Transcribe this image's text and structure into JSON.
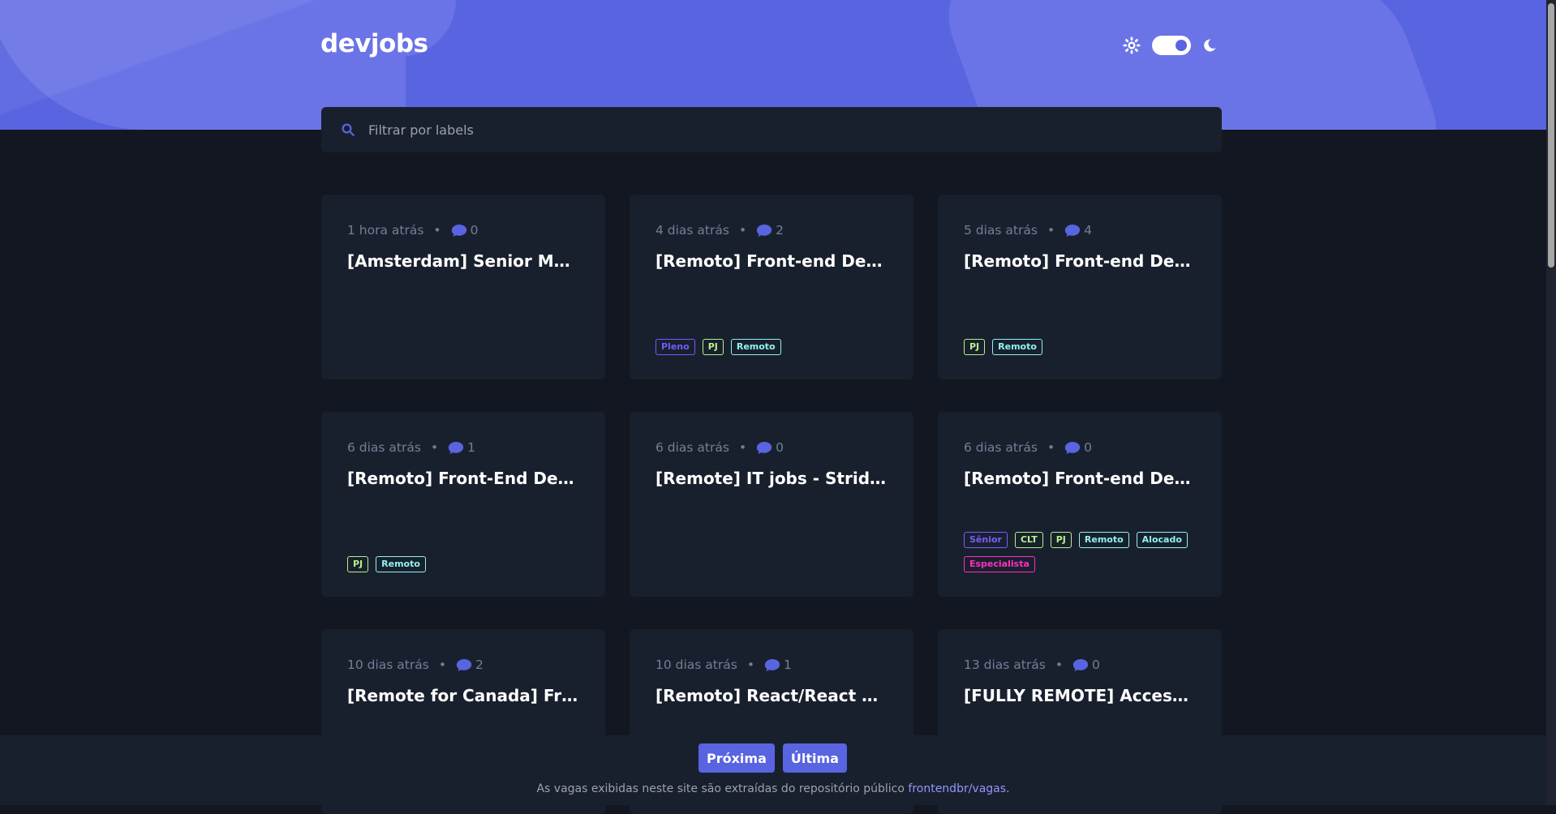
{
  "brand": {
    "logo": "devjobs"
  },
  "theme": {
    "mode": "dark"
  },
  "search": {
    "placeholder": "Filtrar por labels",
    "value": ""
  },
  "colors": {
    "accent": "#5964e0",
    "background": "#121721",
    "card": "#19202d",
    "tag_pleno": "#6f5bff",
    "tag_senior": "#7a5cff",
    "tag_pj": "#b6f08a",
    "tag_clt": "#b6f08a",
    "tag_remoto": "#8ff3ee",
    "tag_alocado": "#8ff3ee",
    "tag_especialista": "#ff2fbf"
  },
  "jobs": [
    {
      "time": "1 hora atrás",
      "comments": "0",
      "title": "[Amsterdam] Senior Mobile Engineer",
      "tags": []
    },
    {
      "time": "4 dias atrás",
      "comments": "2",
      "title": "[Remoto] Front-end Developer",
      "tags": [
        {
          "label": "Pleno",
          "color": "#6f5bff"
        },
        {
          "label": "PJ",
          "color": "#b6f08a"
        },
        {
          "label": "Remoto",
          "color": "#8ff3ee"
        }
      ]
    },
    {
      "time": "5 dias atrás",
      "comments": "4",
      "title": "[Remoto] Front-end Developer",
      "tags": [
        {
          "label": "PJ",
          "color": "#b6f08a"
        },
        {
          "label": "Remoto",
          "color": "#8ff3ee"
        }
      ]
    },
    {
      "time": "6 dias atrás",
      "comments": "1",
      "title": "[Remoto] Front-End Developer",
      "tags": [
        {
          "label": "PJ",
          "color": "#b6f08a"
        },
        {
          "label": "Remoto",
          "color": "#8ff3ee"
        }
      ]
    },
    {
      "time": "6 dias atrás",
      "comments": "0",
      "title": "[Remote] IT jobs - Strider",
      "tags": []
    },
    {
      "time": "6 dias atrás",
      "comments": "0",
      "title": "[Remoto] Front-end Developer",
      "tags": [
        {
          "label": "Sênior",
          "color": "#7a5cff"
        },
        {
          "label": "CLT",
          "color": "#b6f08a"
        },
        {
          "label": "PJ",
          "color": "#b6f08a"
        },
        {
          "label": "Remoto",
          "color": "#8ff3ee"
        },
        {
          "label": "Alocado",
          "color": "#8ff3ee"
        },
        {
          "label": "Especialista",
          "color": "#ff2fbf"
        }
      ]
    },
    {
      "time": "10 dias atrás",
      "comments": "2",
      "title": "[Remote for Canada] Frontend Developer",
      "tags": []
    },
    {
      "time": "10 dias atrás",
      "comments": "1",
      "title": "[Remoto] React/React Native Developer",
      "tags": []
    },
    {
      "time": "13 dias atrás",
      "comments": "0",
      "title": "[FULLY REMOTE] Accessibility Engineer",
      "tags": []
    }
  ],
  "pagination": {
    "next_label": "Próxima",
    "last_label": "Última"
  },
  "footer": {
    "text": "As vagas exibidas neste site são extraídas do repositório público ",
    "link_label": "frontendbr/vagas",
    "period": "."
  }
}
